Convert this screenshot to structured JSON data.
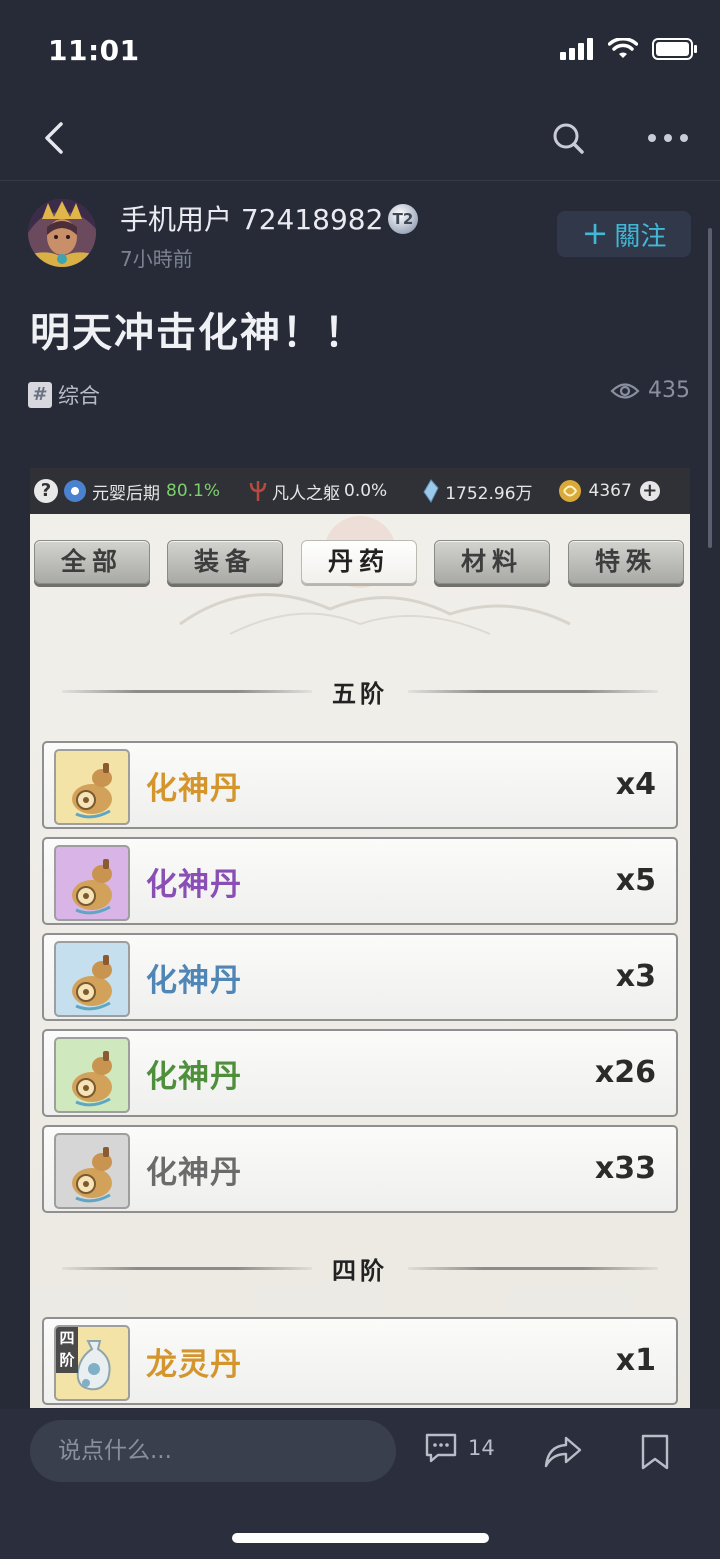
{
  "status": {
    "time": "11:01"
  },
  "post": {
    "username": "手机用户 72418982",
    "badge": "T2",
    "time_ago": "7小時前",
    "follow_label": "關注",
    "title": "明天冲击化神！！",
    "tag": "综合",
    "views": "435"
  },
  "game": {
    "top": {
      "realm": "元婴后期",
      "realm_pct": "80.1%",
      "body": "凡人之躯",
      "body_pct": "0.0%",
      "spirit_stones": "1752.96万",
      "gold": "4367"
    },
    "tabs": [
      "全部",
      "装备",
      "丹药",
      "材料",
      "特殊"
    ],
    "active_tab": "丹药",
    "sections": [
      {
        "title": "五阶",
        "items": [
          {
            "name": "化神丹",
            "qty": "x4",
            "color": "#d4962c"
          },
          {
            "name": "化神丹",
            "qty": "x5",
            "color": "#8a4fb5"
          },
          {
            "name": "化神丹",
            "qty": "x3",
            "color": "#4f86b5"
          },
          {
            "name": "化神丹",
            "qty": "x26",
            "color": "#4f8f3c"
          },
          {
            "name": "化神丹",
            "qty": "x33",
            "color": "#6b6b6b"
          }
        ]
      },
      {
        "title": "四阶",
        "items": [
          {
            "name": "龙灵丹",
            "qty": "x1",
            "color": "#d4962c",
            "tier_label": "四阶"
          }
        ]
      }
    ]
  },
  "bottom": {
    "comment_placeholder": "说点什么...",
    "comment_count": "14"
  },
  "icons": {
    "back": "chevron-left-icon",
    "search": "search-icon",
    "more": "more-icon",
    "views": "eye-icon",
    "comment": "comment-icon",
    "share": "share-icon",
    "bookmark": "bookmark-icon"
  },
  "colors": {
    "background": "#272b38",
    "accent": "#42b7d6",
    "realm_pct": "#7ccf6d"
  }
}
